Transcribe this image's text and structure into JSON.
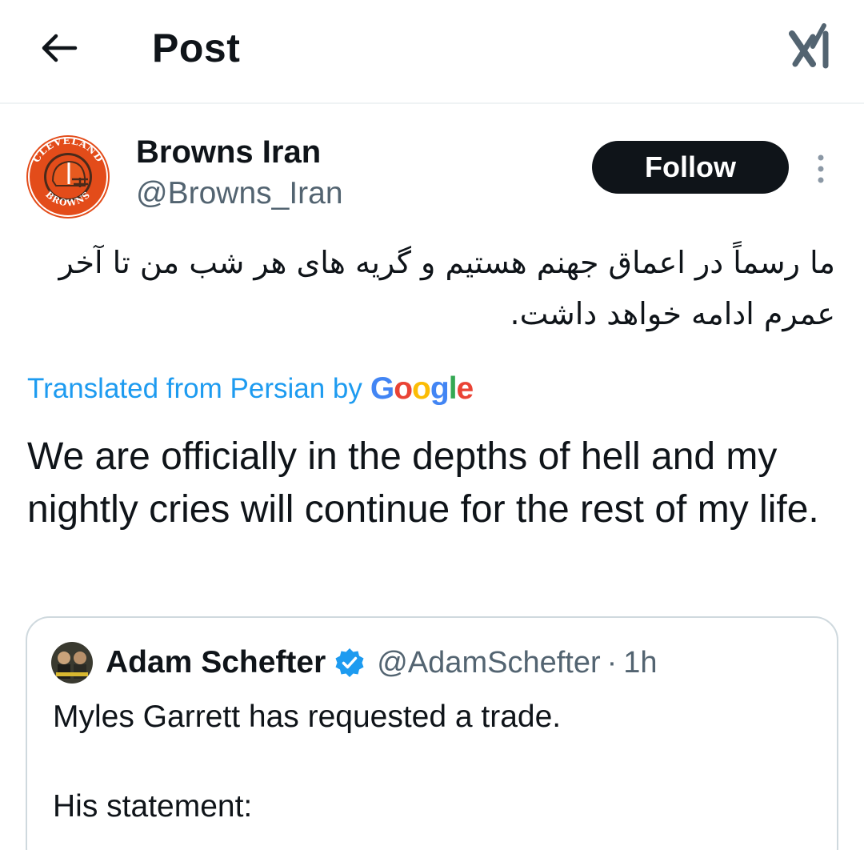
{
  "header": {
    "title": "Post",
    "back_icon": "arrow-left-icon",
    "grok_icon": "grok-icon"
  },
  "author": {
    "display_name": "Browns Iran",
    "handle": "@Browns_Iran",
    "avatar_top_text": "CLEVELAND",
    "avatar_bottom_text": "BROWNS",
    "follow_label": "Follow",
    "more_icon": "more-vertical-icon"
  },
  "post": {
    "original_text": "ما رسماً در اعماق جهنم هستیم و گریه های هر شب من تا آخر عمرم ادامه خواهد داشت.",
    "translated_from": "Translated from Persian by",
    "translator": "Google",
    "translated_text": "We are officially in the depths of hell and my nightly cries will continue for the rest of my life."
  },
  "quote": {
    "name": "Adam Schefter",
    "handle": "@AdamSchefter",
    "separator": "·",
    "time": "1h",
    "text": "Myles Garrett has requested a trade.",
    "text_line2": "His statement:"
  },
  "colors": {
    "link_blue": "#1d9bf0",
    "text_primary": "#0f1419",
    "text_secondary": "#536471",
    "browns_orange": "#e34c1a",
    "browns_brown": "#4a2a1a"
  }
}
